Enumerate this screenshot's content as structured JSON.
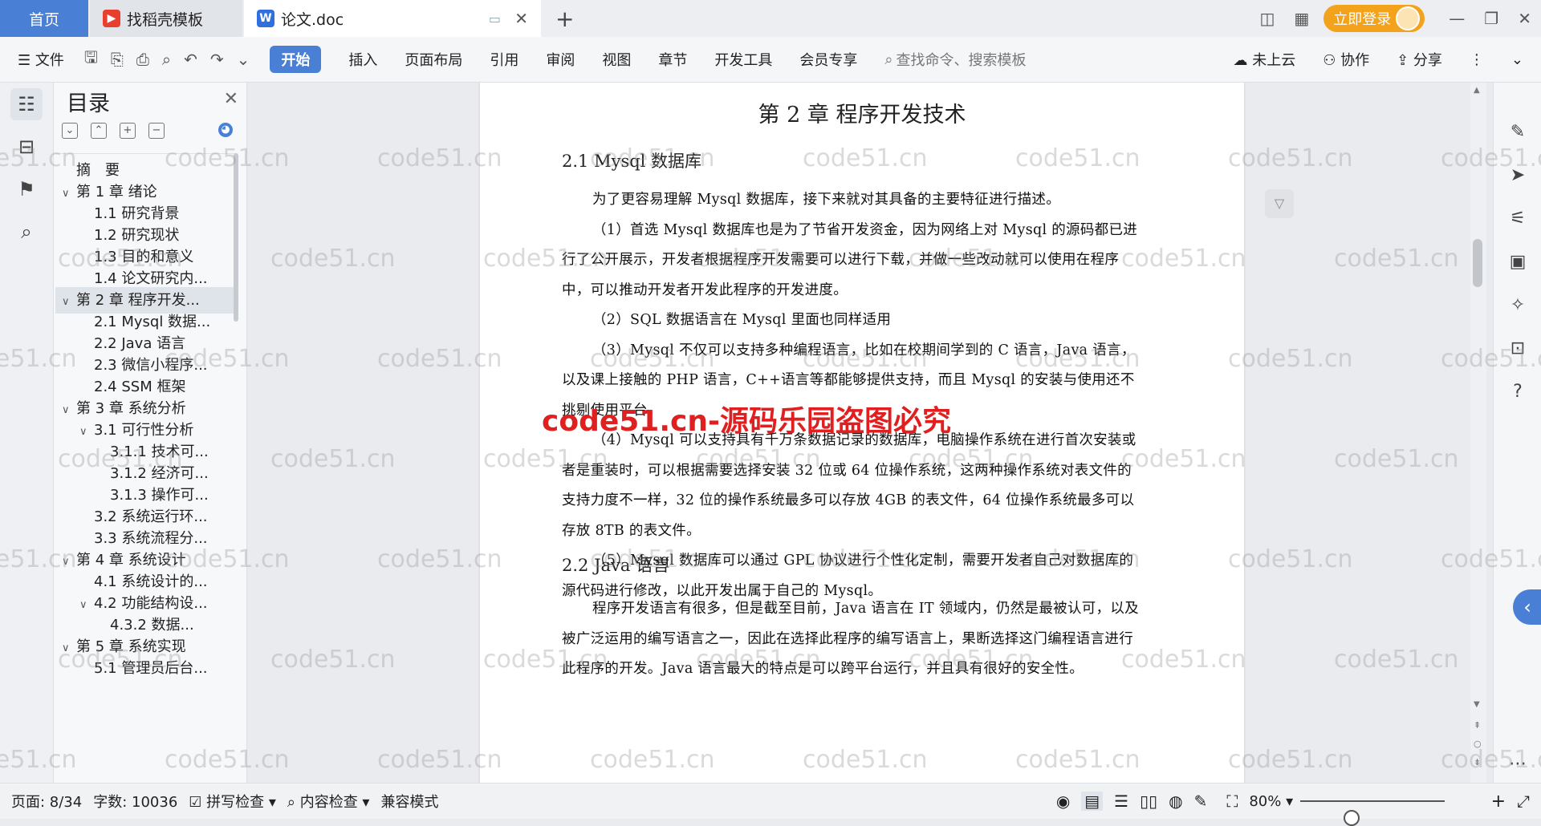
{
  "titlebar": {
    "home_tab": "首页",
    "daoke_tab": "找稻壳模板",
    "doc_tab": "论文.doc",
    "login_label": "立即登录"
  },
  "ribbon": {
    "file": "文件",
    "tabs": [
      "开始",
      "插入",
      "页面布局",
      "引用",
      "审阅",
      "视图",
      "章节",
      "开发工具",
      "会员专享"
    ],
    "search_placeholder": "查找命令、搜索模板",
    "cloud": "未上云",
    "collab": "协作",
    "share": "分享"
  },
  "toc": {
    "title": "目录",
    "items": [
      {
        "label": "摘　要",
        "level": 0,
        "caret": ""
      },
      {
        "label": "第 1 章  绪论",
        "level": 0,
        "caret": "v"
      },
      {
        "label": "1.1  研究背景",
        "level": 1,
        "caret": ""
      },
      {
        "label": "1.2  研究现状",
        "level": 1,
        "caret": ""
      },
      {
        "label": "1.3  目的和意义",
        "level": 1,
        "caret": ""
      },
      {
        "label": "1.4  论文研究内...",
        "level": 1,
        "caret": ""
      },
      {
        "label": "第 2 章  程序开发...",
        "level": 0,
        "caret": "v",
        "selected": true
      },
      {
        "label": "2.1 Mysql 数据...",
        "level": 1,
        "caret": ""
      },
      {
        "label": "2.2 Java 语言",
        "level": 1,
        "caret": ""
      },
      {
        "label": "2.3  微信小程序...",
        "level": 1,
        "caret": ""
      },
      {
        "label": "2.4 SSM 框架",
        "level": 1,
        "caret": ""
      },
      {
        "label": "第 3 章  系统分析",
        "level": 0,
        "caret": "v"
      },
      {
        "label": "3.1 可行性分析",
        "level": 1,
        "caret": "v"
      },
      {
        "label": "3.1.1 技术可...",
        "level": 2,
        "caret": ""
      },
      {
        "label": "3.1.2 经济可...",
        "level": 2,
        "caret": ""
      },
      {
        "label": "3.1.3 操作可...",
        "level": 2,
        "caret": ""
      },
      {
        "label": "3.2 系统运行环...",
        "level": 1,
        "caret": ""
      },
      {
        "label": "3.3 系统流程分...",
        "level": 1,
        "caret": ""
      },
      {
        "label": "第 4 章  系统设计",
        "level": 0,
        "caret": "v"
      },
      {
        "label": "4.1  系统设计的...",
        "level": 1,
        "caret": ""
      },
      {
        "label": "4.2  功能结构设...",
        "level": 1,
        "caret": "v"
      },
      {
        "label": "4.3.2  数据...",
        "level": 2,
        "caret": ""
      },
      {
        "label": "第 5 章  系统实现",
        "level": 0,
        "caret": "v"
      },
      {
        "label": "5.1 管理员后台...",
        "level": 1,
        "caret": ""
      }
    ]
  },
  "document": {
    "chapter_title": "第 2 章  程序开发技术",
    "section1_title": "2.1 Mysql 数据库",
    "paragraphs1": [
      "为了更容易理解 Mysql 数据库，接下来就对其具备的主要特征进行描述。",
      "（1）首选 Mysql 数据库也是为了节省开发资金，因为网络上对 Mysql 的源码都已进行了公开展示，开发者根据程序开发需要可以进行下载，并做一些改动就可以使用在程序中，可以推动开发者开发此程序的开发进度。",
      "（2）SQL 数据语言在 Mysql 里面也同样适用",
      "（3）Mysql 不仅可以支持多种编程语言，比如在校期间学到的 C 语言，Java 语言，以及课上接触的 PHP 语言，C++语言等都能够提供支持，而且 Mysql 的安装与使用还不挑剔使用平台。",
      "（4）Mysql 可以支持具有千万条数据记录的数据库，电脑操作系统在进行首次安装或者是重装时，可以根据需要选择安装 32 位或 64 位操作系统，这两种操作系统对表文件的支持力度不一样，32 位的操作系统最多可以存放 4GB 的表文件，64 位操作系统最多可以存放 8TB 的表文件。",
      "（5）Mysql 数据库可以通过 GPL 协议进行个性化定制，需要开发者自己对数据库的源代码进行修改，以此开发出属于自己的 Mysql。"
    ],
    "section2_title": "2.2 Java 语言",
    "paragraphs2": [
      "程序开发语言有很多，但是截至目前，Java 语言在 IT 领域内，仍然是最被认可，以及被广泛运用的编写语言之一，因此在选择此程序的编写语言上，果断选择这门编程语言进行此程序的开发。Java 语言最大的特点是可以跨平台运行，并且具有很好的安全性。"
    ]
  },
  "watermark": {
    "text": "code51.cn",
    "big_text": "code51.cn-源码乐园盗图必究"
  },
  "status": {
    "page": "页面: 8/34",
    "words": "字数: 10036",
    "spell": "拼写检查",
    "content_check": "内容检查",
    "compat": "兼容模式",
    "zoom": "80%",
    "zoom_fraction": 0.35
  },
  "colors": {
    "accent": "#4a7fd6",
    "login": "#f2a21b",
    "watermark_red": "#e02020"
  }
}
